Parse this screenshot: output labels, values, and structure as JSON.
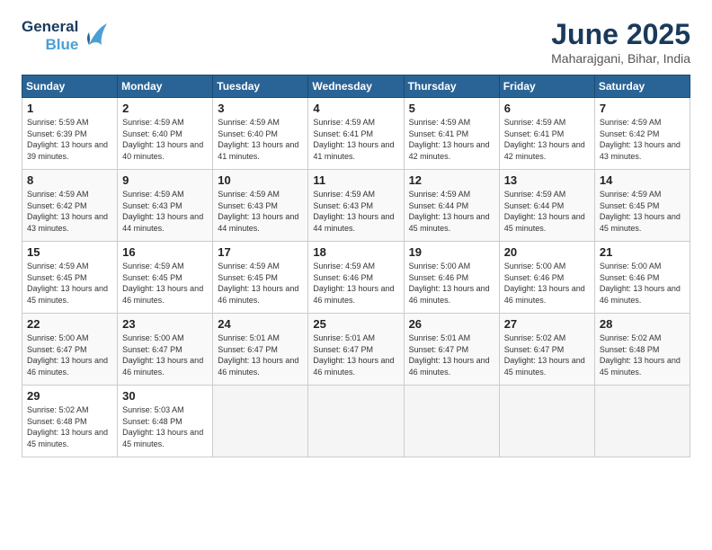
{
  "logo": {
    "line1": "General",
    "line2": "Blue"
  },
  "title": "June 2025",
  "location": "Maharajgani, Bihar, India",
  "weekdays": [
    "Sunday",
    "Monday",
    "Tuesday",
    "Wednesday",
    "Thursday",
    "Friday",
    "Saturday"
  ],
  "days": [
    {
      "date": 1,
      "sunrise": "5:59 AM",
      "sunset": "6:39 PM",
      "daylight": "13 hours and 39 minutes."
    },
    {
      "date": 2,
      "sunrise": "4:59 AM",
      "sunset": "6:40 PM",
      "daylight": "13 hours and 40 minutes."
    },
    {
      "date": 3,
      "sunrise": "4:59 AM",
      "sunset": "6:40 PM",
      "daylight": "13 hours and 41 minutes."
    },
    {
      "date": 4,
      "sunrise": "4:59 AM",
      "sunset": "6:41 PM",
      "daylight": "13 hours and 41 minutes."
    },
    {
      "date": 5,
      "sunrise": "4:59 AM",
      "sunset": "6:41 PM",
      "daylight": "13 hours and 42 minutes."
    },
    {
      "date": 6,
      "sunrise": "4:59 AM",
      "sunset": "6:41 PM",
      "daylight": "13 hours and 42 minutes."
    },
    {
      "date": 7,
      "sunrise": "4:59 AM",
      "sunset": "6:42 PM",
      "daylight": "13 hours and 43 minutes."
    },
    {
      "date": 8,
      "sunrise": "4:59 AM",
      "sunset": "6:42 PM",
      "daylight": "13 hours and 43 minutes."
    },
    {
      "date": 9,
      "sunrise": "4:59 AM",
      "sunset": "6:43 PM",
      "daylight": "13 hours and 44 minutes."
    },
    {
      "date": 10,
      "sunrise": "4:59 AM",
      "sunset": "6:43 PM",
      "daylight": "13 hours and 44 minutes."
    },
    {
      "date": 11,
      "sunrise": "4:59 AM",
      "sunset": "6:43 PM",
      "daylight": "13 hours and 44 minutes."
    },
    {
      "date": 12,
      "sunrise": "4:59 AM",
      "sunset": "6:44 PM",
      "daylight": "13 hours and 45 minutes."
    },
    {
      "date": 13,
      "sunrise": "4:59 AM",
      "sunset": "6:44 PM",
      "daylight": "13 hours and 45 minutes."
    },
    {
      "date": 14,
      "sunrise": "4:59 AM",
      "sunset": "6:45 PM",
      "daylight": "13 hours and 45 minutes."
    },
    {
      "date": 15,
      "sunrise": "4:59 AM",
      "sunset": "6:45 PM",
      "daylight": "13 hours and 45 minutes."
    },
    {
      "date": 16,
      "sunrise": "4:59 AM",
      "sunset": "6:45 PM",
      "daylight": "13 hours and 46 minutes."
    },
    {
      "date": 17,
      "sunrise": "4:59 AM",
      "sunset": "6:45 PM",
      "daylight": "13 hours and 46 minutes."
    },
    {
      "date": 18,
      "sunrise": "4:59 AM",
      "sunset": "6:46 PM",
      "daylight": "13 hours and 46 minutes."
    },
    {
      "date": 19,
      "sunrise": "5:00 AM",
      "sunset": "6:46 PM",
      "daylight": "13 hours and 46 minutes."
    },
    {
      "date": 20,
      "sunrise": "5:00 AM",
      "sunset": "6:46 PM",
      "daylight": "13 hours and 46 minutes."
    },
    {
      "date": 21,
      "sunrise": "5:00 AM",
      "sunset": "6:46 PM",
      "daylight": "13 hours and 46 minutes."
    },
    {
      "date": 22,
      "sunrise": "5:00 AM",
      "sunset": "6:47 PM",
      "daylight": "13 hours and 46 minutes."
    },
    {
      "date": 23,
      "sunrise": "5:00 AM",
      "sunset": "6:47 PM",
      "daylight": "13 hours and 46 minutes."
    },
    {
      "date": 24,
      "sunrise": "5:01 AM",
      "sunset": "6:47 PM",
      "daylight": "13 hours and 46 minutes."
    },
    {
      "date": 25,
      "sunrise": "5:01 AM",
      "sunset": "6:47 PM",
      "daylight": "13 hours and 46 minutes."
    },
    {
      "date": 26,
      "sunrise": "5:01 AM",
      "sunset": "6:47 PM",
      "daylight": "13 hours and 46 minutes."
    },
    {
      "date": 27,
      "sunrise": "5:02 AM",
      "sunset": "6:47 PM",
      "daylight": "13 hours and 45 minutes."
    },
    {
      "date": 28,
      "sunrise": "5:02 AM",
      "sunset": "6:48 PM",
      "daylight": "13 hours and 45 minutes."
    },
    {
      "date": 29,
      "sunrise": "5:02 AM",
      "sunset": "6:48 PM",
      "daylight": "13 hours and 45 minutes."
    },
    {
      "date": 30,
      "sunrise": "5:03 AM",
      "sunset": "6:48 PM",
      "daylight": "13 hours and 45 minutes."
    }
  ],
  "startDayOfWeek": 0,
  "labels": {
    "sunrise": "Sunrise:",
    "sunset": "Sunset:",
    "daylight": "Daylight:"
  }
}
